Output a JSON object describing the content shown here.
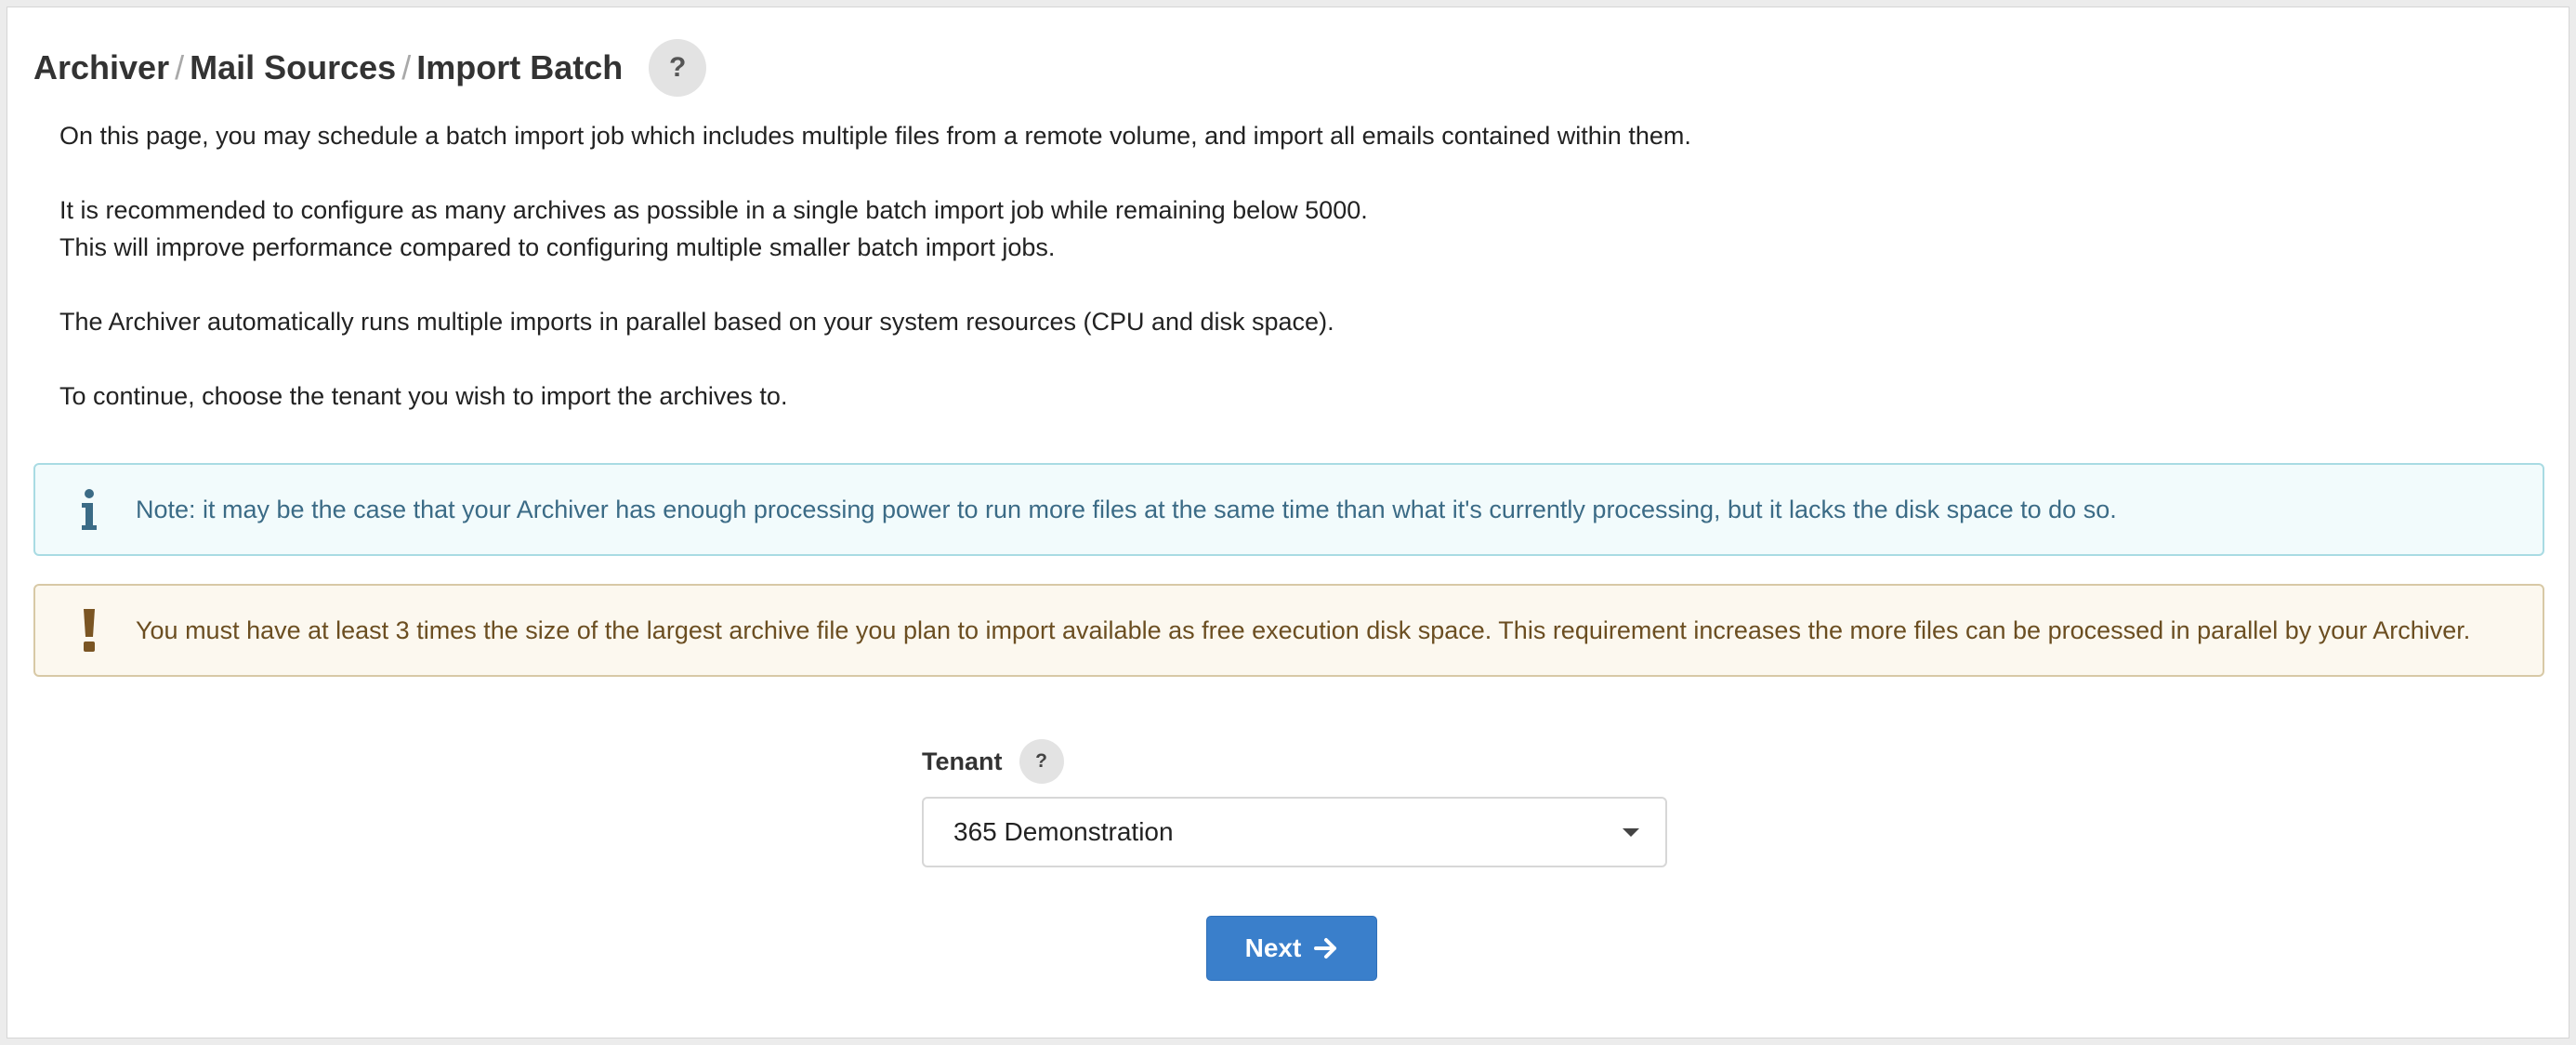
{
  "breadcrumb": {
    "items": [
      "Archiver",
      "Mail Sources",
      "Import Batch"
    ],
    "separator": "/"
  },
  "header": {
    "help_label": "?"
  },
  "intro": {
    "p1": "On this page, you may schedule a batch import job which includes multiple files from a remote volume, and import all emails contained within them.",
    "p2a": "It is recommended to configure as many archives as possible in a single batch import job while remaining below 5000.",
    "p2b": "This will improve performance compared to configuring multiple smaller batch import jobs.",
    "p3": "The Archiver automatically runs multiple imports in parallel based on your system resources (CPU and disk space).",
    "p4": "To continue, choose the tenant you wish to import the archives to."
  },
  "alerts": {
    "info": {
      "icon": "info-icon",
      "text": "Note: it may be the case that your Archiver has enough processing power to run more files at the same time than what it's currently processing, but it lacks the disk space to do so."
    },
    "warning": {
      "icon": "exclamation-icon",
      "text": "You must have at least 3 times the size of the largest archive file you plan to import available as free execution disk space. This requirement increases the more files can be processed in parallel by your Archiver."
    }
  },
  "form": {
    "tenant_label": "Tenant",
    "tenant_help": "?",
    "tenant_value": "365 Demonstration"
  },
  "actions": {
    "next_label": "Next"
  },
  "colors": {
    "primary": "#3a7fcb",
    "info_text": "#3b6b86",
    "info_bg": "#f2fbfc",
    "warning_text": "#6b4e21",
    "warning_bg": "#fcf8ef"
  }
}
